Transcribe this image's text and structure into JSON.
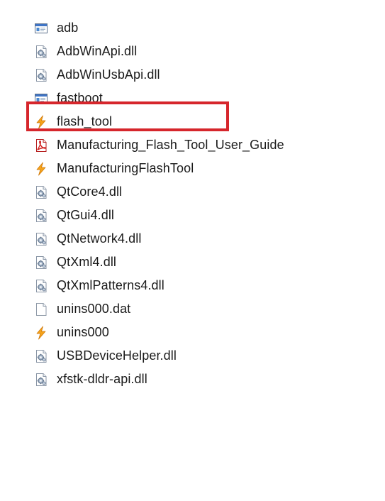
{
  "files": [
    {
      "name": "adb",
      "icon": "application-window-icon"
    },
    {
      "name": "AdbWinApi.dll",
      "icon": "dll-gear-icon"
    },
    {
      "name": "AdbWinUsbApi.dll",
      "icon": "dll-gear-icon"
    },
    {
      "name": "fastboot",
      "icon": "application-window-icon"
    },
    {
      "name": "flash_tool",
      "icon": "lightning-bolt-icon"
    },
    {
      "name": "Manufacturing_Flash_Tool_User_Guide",
      "icon": "pdf-document-icon"
    },
    {
      "name": "ManufacturingFlashTool",
      "icon": "lightning-bolt-icon"
    },
    {
      "name": "QtCore4.dll",
      "icon": "dll-gear-icon"
    },
    {
      "name": "QtGui4.dll",
      "icon": "dll-gear-icon"
    },
    {
      "name": "QtNetwork4.dll",
      "icon": "dll-gear-icon"
    },
    {
      "name": "QtXml4.dll",
      "icon": "dll-gear-icon"
    },
    {
      "name": "QtXmlPatterns4.dll",
      "icon": "dll-gear-icon"
    },
    {
      "name": "unins000.dat",
      "icon": "blank-file-icon"
    },
    {
      "name": "unins000",
      "icon": "lightning-bolt-icon"
    },
    {
      "name": "USBDeviceHelper.dll",
      "icon": "dll-gear-icon"
    },
    {
      "name": "xfstk-dldr-api.dll",
      "icon": "dll-gear-icon"
    }
  ],
  "highlighted_item": "fastboot",
  "colors": {
    "highlight_border": "#d6262c",
    "text": "#1a1a1a",
    "background": "#ffffff"
  }
}
